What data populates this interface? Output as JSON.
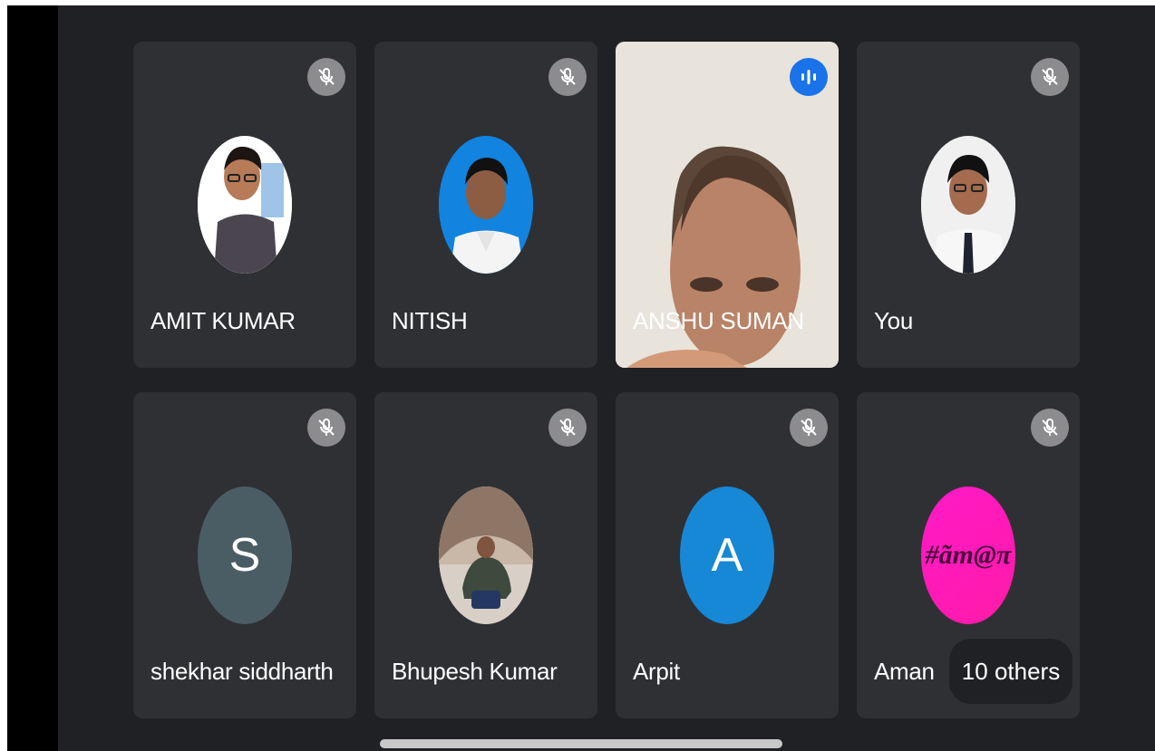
{
  "participants": [
    {
      "name": "AMIT KUMAR",
      "status": "muted",
      "avatar": "photo"
    },
    {
      "name": "NITISH",
      "status": "muted",
      "avatar": "photo"
    },
    {
      "name": "ANSHU SUMAN",
      "status": "speaking",
      "avatar": "video"
    },
    {
      "name": "You",
      "status": "muted",
      "avatar": "photo"
    },
    {
      "name": "shekhar siddharth",
      "status": "muted",
      "avatar": "initial",
      "initial": "S",
      "color": "#4a5d65"
    },
    {
      "name": "Bhupesh Kumar",
      "status": "muted",
      "avatar": "photo"
    },
    {
      "name": "Arpit",
      "status": "muted",
      "avatar": "initial",
      "initial": "A",
      "color": "#1688d5"
    },
    {
      "name": "Aman",
      "status": "muted",
      "avatar": "text",
      "avatar_text": "#ãm@π"
    }
  ],
  "others": {
    "label": "10 others"
  },
  "colors": {
    "tile": "#2f3034",
    "speaking": "#1a73e8",
    "muted_badge": "#8c8c8f",
    "aman_avatar": "#ff1fd0"
  }
}
